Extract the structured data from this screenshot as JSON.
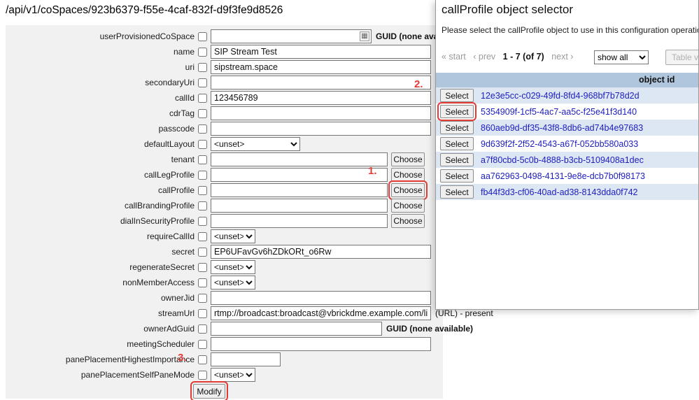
{
  "page": {
    "title": "/api/v1/coSpaces/923b6379-f55e-4caf-832f-d9f3fe9d8526"
  },
  "form": {
    "modify_label": "Modify",
    "rows": [
      {
        "label": "userProvisionedCoSpace",
        "type": "guid-picker",
        "value": "",
        "extra": "GUID (none available)",
        "extra_bold": true
      },
      {
        "label": "name",
        "type": "text",
        "value": "SIP Stream Test"
      },
      {
        "label": "uri",
        "type": "text",
        "value": "sipstream.space"
      },
      {
        "label": "secondaryUri",
        "type": "text",
        "value": ""
      },
      {
        "label": "callId",
        "type": "text",
        "value": "123456789"
      },
      {
        "label": "cdrTag",
        "type": "text",
        "value": ""
      },
      {
        "label": "passcode",
        "type": "text",
        "value": ""
      },
      {
        "label": "defaultLayout",
        "type": "select",
        "value": "<unset>",
        "select_width": 128
      },
      {
        "label": "tenant",
        "type": "choose",
        "value": "",
        "button": "Choose"
      },
      {
        "label": "callLegProfile",
        "type": "choose",
        "value": "",
        "button": "Choose"
      },
      {
        "label": "callProfile",
        "type": "choose",
        "value": "",
        "button": "Choose",
        "highlight": true
      },
      {
        "label": "callBrandingProfile",
        "type": "choose",
        "value": "",
        "button": "Choose"
      },
      {
        "label": "dialInSecurityProfile",
        "type": "choose",
        "value": "",
        "button": "Choose"
      },
      {
        "label": "requireCallId",
        "type": "select",
        "value": "<unset>",
        "select_width": 64
      },
      {
        "label": "secret",
        "type": "text",
        "value": "EP6UFavGv6hZDkORt_o6Rw"
      },
      {
        "label": "regenerateSecret",
        "type": "select",
        "value": "<unset>",
        "select_width": 64
      },
      {
        "label": "nonMemberAccess",
        "type": "select",
        "value": "<unset>",
        "select_width": 64
      },
      {
        "label": "ownerJid",
        "type": "text",
        "value": ""
      },
      {
        "label": "streamUrl",
        "type": "text-extra",
        "value": "rtmp://broadcast:broadcast@vbrickdme.example.com/live/C",
        "extra": "(URL) - present",
        "extra_bold": false
      },
      {
        "label": "ownerAdGuid",
        "type": "text-extra",
        "value": "",
        "extra": "GUID (none available)",
        "extra_bold": true,
        "input_width": 245
      },
      {
        "label": "meetingScheduler",
        "type": "text",
        "value": ""
      },
      {
        "label": "panePlacementHighestImportance",
        "type": "text",
        "value": "",
        "input_width": 100
      },
      {
        "label": "panePlacementSelfPaneMode",
        "type": "select",
        "value": "<unset>",
        "select_width": 64
      }
    ]
  },
  "popup": {
    "title": "callProfile object selector",
    "description": "Please select the callProfile object to use in this configuration operation.",
    "pager": {
      "start": "« start",
      "prev": "‹ prev",
      "range": "1 - 7 (of 7)",
      "next": "next ›",
      "filter": "show all",
      "table_view": "Table view"
    },
    "table": {
      "header": "object id",
      "select_label": "Select",
      "rows": [
        {
          "id": "12e3e5cc-c029-49fd-8fd4-968bf7b78d2d",
          "highlight": false
        },
        {
          "id": "5354909f-1cf5-4ac7-aa5c-f25e41f3d140",
          "highlight": true
        },
        {
          "id": "860aeb9d-df35-43f8-8db6-ad74b4e97683",
          "highlight": false
        },
        {
          "id": "9d639f2f-2f52-4543-a67f-052bb580a033",
          "highlight": false
        },
        {
          "id": "a7f80cbd-5c0b-4888-b3cb-5109408a1dec",
          "highlight": false
        },
        {
          "id": "aa762963-0498-4131-9e8e-dcb7b0f98173",
          "highlight": false
        },
        {
          "id": "fb44f3d3-cf06-40ad-ad38-8143dda0f742",
          "highlight": false
        }
      ]
    }
  },
  "annotations": {
    "step1": "1.",
    "step2": "2.",
    "step3": "3."
  },
  "colors": {
    "annotation_red": "#e33b35",
    "link_blue": "#2020c0",
    "table_header_bg": "#b0c6dc",
    "table_row_alt_bg": "#dce7f3",
    "form_bg": "#f1f1f1"
  }
}
